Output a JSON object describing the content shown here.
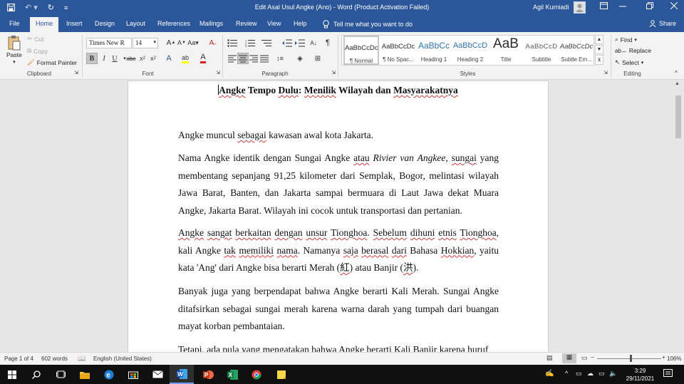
{
  "window": {
    "title": "Edit Asal Usul Angke (Ano) - Word (Product Activation Failed)",
    "user": "Agil Kurniadi"
  },
  "tabs": [
    "File",
    "Home",
    "Insert",
    "Design",
    "Layout",
    "References",
    "Mailings",
    "Review",
    "View",
    "Help"
  ],
  "active_tab": "Home",
  "tell_me": "Tell me what you want to do",
  "share": "Share",
  "ribbon": {
    "clipboard": {
      "label": "Clipboard",
      "paste": "Paste",
      "cut": "Cut",
      "copy": "Copy",
      "format_painter": "Format Painter"
    },
    "font": {
      "label": "Font",
      "family": "Times New R",
      "size": "14"
    },
    "paragraph": {
      "label": "Paragraph"
    },
    "styles": {
      "label": "Styles",
      "items": [
        {
          "preview": "AaBbCcDc",
          "name": "¶ Normal"
        },
        {
          "preview": "AaBbCcDc",
          "name": "¶ No Spac..."
        },
        {
          "preview": "AaBbCc",
          "name": "Heading 1"
        },
        {
          "preview": "AaBbCcD",
          "name": "Heading 2"
        },
        {
          "preview": "AaB",
          "name": "Title"
        },
        {
          "preview": "AaBbCcD",
          "name": "Subtitle"
        },
        {
          "preview": "AaBbCcDc",
          "name": "Subtle Em..."
        }
      ]
    },
    "editing": {
      "label": "Editing",
      "find": "Find",
      "replace": "Replace",
      "select": "Select"
    }
  },
  "document": {
    "heading_parts": [
      "Angke",
      " Tempo ",
      "Dulu",
      ": ",
      "Menilik",
      " Wilayah dan ",
      "Masyarakatnya"
    ],
    "p1": [
      "Angke muncul ",
      "sebagai",
      " kawasan awal kota Jakarta."
    ],
    "p2": [
      "Nama Angke identik dengan Sungai Angke ",
      "atau",
      " ",
      "Rivier van Angkee",
      ", ",
      "sungai",
      " yang membentang sepanjang 91,25 kilometer dari Semplak, Bogor, melintasi wilayah Jawa Barat, Banten, dan Jakarta sampai bermuara di Laut Jawa dekat Muara Angke, Jakarta Barat. Wilayah ini cocok untuk transportasi dan pertanian."
    ],
    "p3": [
      "Angke",
      " ",
      "sangat",
      " ",
      "berkaitan",
      " ",
      "dengan",
      " ",
      "unsur",
      " ",
      "Tionghoa",
      ". ",
      "Sebelum",
      " ",
      "dihuni",
      " ",
      "etnis",
      " ",
      "Tionghoa",
      ", kali Angke ",
      "tak",
      " ",
      "memiliki",
      " ",
      "nama",
      ". Namanya ",
      "saja",
      " ",
      "berasal",
      " ",
      "dari",
      " Bahasa ",
      "Hokkian",
      ", yaitu kata 'Ang' dari Angke bisa berarti Merah (",
      "紅",
      ") atau Banjir (",
      "洪",
      ")."
    ],
    "p4": [
      "Banyak juga yang berpendapat bahwa Angke berarti Kali Merah. Sungai Angke ditafsirkan sebagai sungai merah karena warna darah yang tumpah dari buangan mayat korban pembantaian."
    ],
    "p5": [
      "Tetapi",
      ", ada pula yang mengatakan bahwa Angke berarti Kali Banjir karena huruf"
    ]
  },
  "status": {
    "page": "Page 1 of 4",
    "words": "602 words",
    "language": "English (United States)",
    "zoom": "106%"
  },
  "clock": {
    "time": "3:29",
    "date": "29/11/2021"
  }
}
